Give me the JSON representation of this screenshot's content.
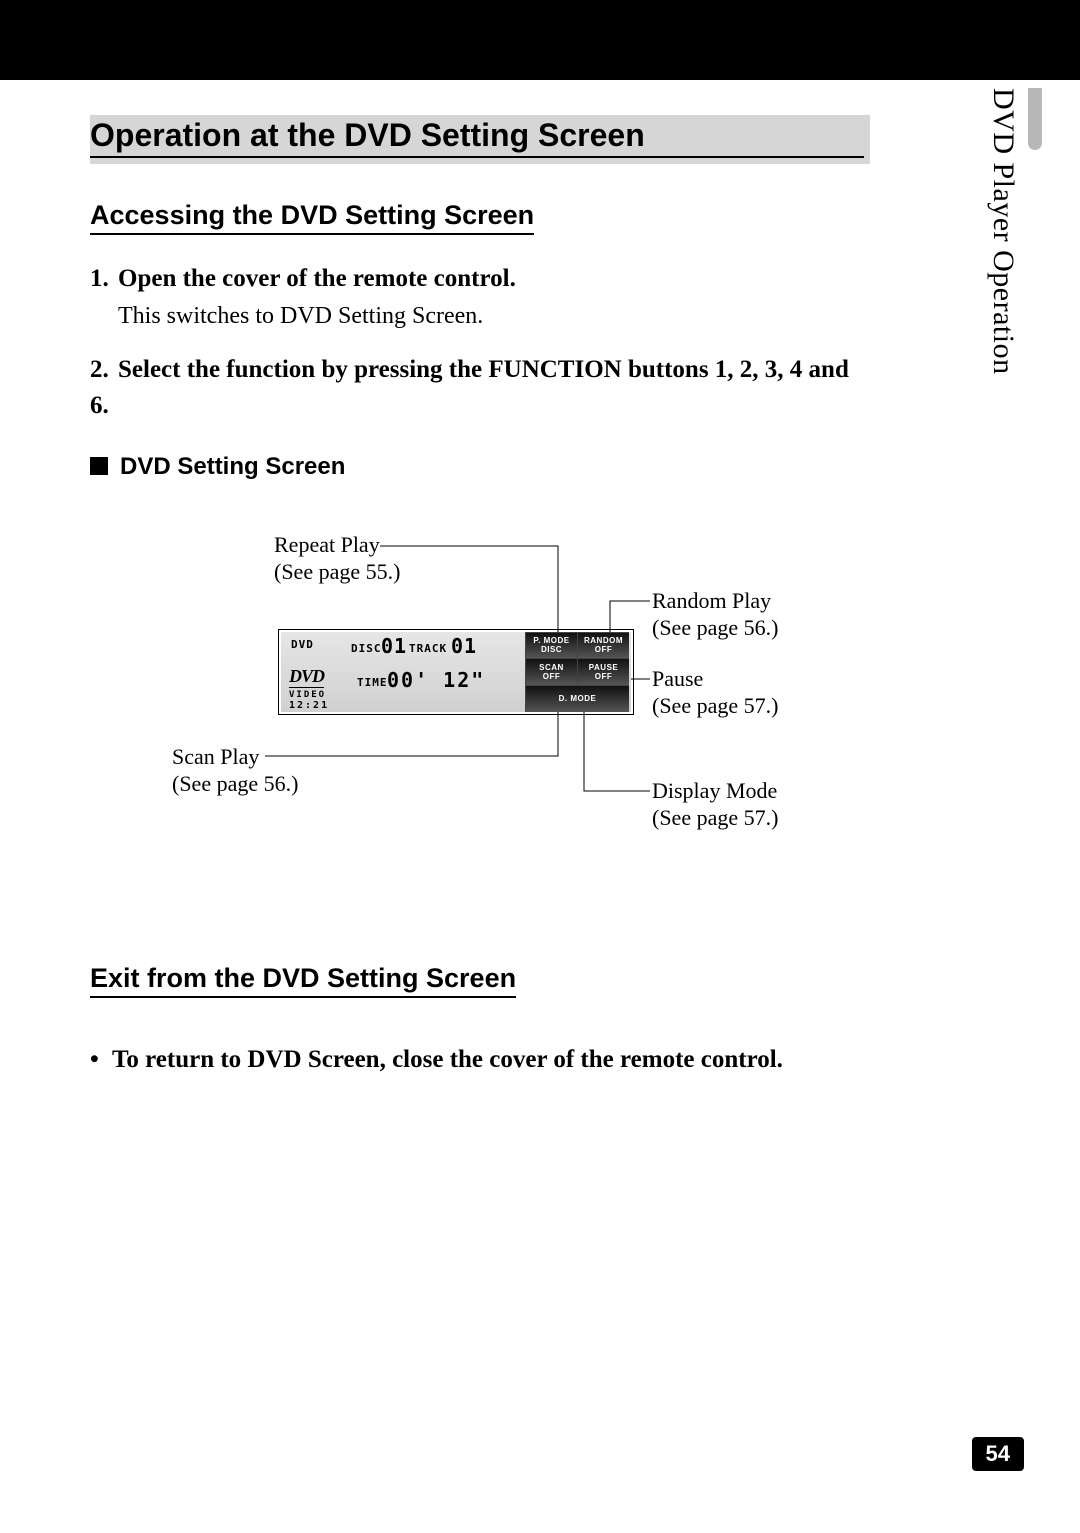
{
  "side_tab": "DVD Player Operation",
  "title": "Operation at the DVD Setting Screen",
  "section1_heading": "Accessing the DVD Setting Screen",
  "steps": [
    {
      "num": "1.",
      "title": "Open the cover of the remote control.",
      "note": "This switches to DVD Setting Screen."
    },
    {
      "num": "2.",
      "title": "Select the function by pressing the FUNCTION buttons 1, 2, 3, 4 and 6.",
      "note": ""
    }
  ],
  "screen_head": "DVD Setting Screen",
  "callouts": {
    "repeat_play": {
      "l1": "Repeat Play",
      "l2": "(See page 55.)"
    },
    "random_play": {
      "l1": "Random Play",
      "l2": "(See page 56.)"
    },
    "pause": {
      "l1": "Pause",
      "l2": "(See page 57.)"
    },
    "scan_play": {
      "l1": "Scan Play",
      "l2": "(See page 56.)"
    },
    "display_mode": {
      "l1": "Display Mode",
      "l2": "(See page 57.)"
    }
  },
  "lcd": {
    "dvd_small": "DVD",
    "disc_label": "DISC",
    "disc_num": "01",
    "track_label": "TRACK",
    "track_num": "01",
    "time_label": "TIME",
    "time_value": "00' 12\"",
    "dvd_logo": "DVD",
    "video": "VIDEO",
    "clock": "12:21",
    "btn_pmode_1": "P. MODE",
    "btn_pmode_2": "DISC",
    "btn_random_1": "RANDOM",
    "btn_random_2": "OFF",
    "btn_scan_1": "SCAN",
    "btn_scan_2": "OFF",
    "btn_pause_1": "PAUSE",
    "btn_pause_2": "OFF",
    "btn_dmode": "D. MODE"
  },
  "section2_heading": "Exit from the DVD Setting Screen",
  "exit_bullet": "To return to DVD Screen, close the cover of the remote control.",
  "page_number": "54"
}
